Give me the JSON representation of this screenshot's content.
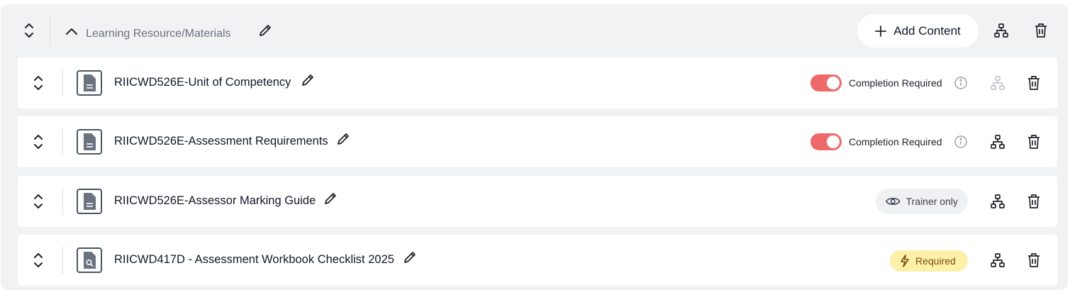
{
  "section": {
    "title": "Learning Resource/Materials",
    "add_content_label": "Add Content"
  },
  "rows": [
    {
      "title": "RIICWD526E-Unit of Competency",
      "doc_icon": "document-icon",
      "status": "Completion Required",
      "toggle_on": true,
      "hierarchy_enabled": false
    },
    {
      "title": "RIICWD526E-Assessment Requirements",
      "doc_icon": "document-icon",
      "status": "Completion Required",
      "toggle_on": true,
      "hierarchy_enabled": true
    },
    {
      "title": "RIICWD526E-Assessor Marking Guide",
      "doc_icon": "document-icon",
      "badge": "Trainer only",
      "badge_icon": "eye-icon",
      "hierarchy_enabled": true
    },
    {
      "title": "RIICWD417D - Assessment Workbook Checklist 2025",
      "doc_icon": "search-document-icon",
      "badge": "Required",
      "badge_icon": "lightning-icon",
      "hierarchy_enabled": true
    }
  ],
  "colors": {
    "toggle_on": "#ee6a6a",
    "required_badge_bg": "#fdf1a9",
    "required_badge_text": "#7a4a0a",
    "section_bg": "#f1f2f4",
    "disabled_icon": "#c4c7cc"
  }
}
